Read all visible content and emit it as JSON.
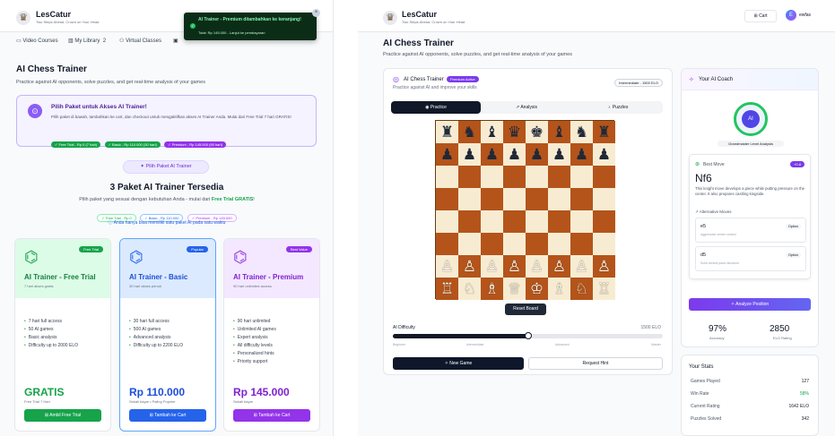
{
  "brand": {
    "name": "LesCatur",
    "tagline": "Two Steps Ahead, Crown on Your Head"
  },
  "left": {
    "nav": [
      {
        "label": "Video Courses",
        "icon": "video-icon"
      },
      {
        "label": "My Library",
        "icon": "library-icon",
        "count": "2"
      },
      {
        "label": "Virtual Classes",
        "icon": "class-icon"
      }
    ],
    "toast": {
      "title": "AI Trainer - Premium ditambahkan ke keranjang!",
      "line": "Total: Rp 145.000 - Lanjut ke pembayaran"
    },
    "page_title": "AI Chess Trainer",
    "page_sub": "Practice against AI opponents, solve puzzles, and get real-time analysis of your games",
    "notice": {
      "title": "Pilih Paket untuk Akses AI Trainer!",
      "body": "Pilih paket di bawah, tambahkan ke cart, dan checkout untuk mengaktifkan akses AI Trainer Anda. Mulai dari Free Trial 7 hari GRATIS!",
      "pills": [
        "✓ Free Trial - Rp 0 (7 hari)",
        "✓ Basic - Rp 110.000 (30 hari)",
        "✓ Premium - Rp 145.000 (90 hari)"
      ]
    },
    "choose_btn": "Pilih Paket AI Trainer",
    "section_title": "3 Paket AI Trainer Tersedia",
    "section_sub_prefix": "Pilih paket yang sesuai dengan kebutuhan Anda - mulai dari ",
    "section_sub_bold": "Free Trial GRATIS",
    "section_sub_suffix": "!",
    "mini_pills": [
      "✓ Free Trial - Rp 0",
      "✓ Basic - Rp 110.000",
      "✓ Premium - Rp 145.000"
    ],
    "info_line": "Anda hanya bisa memiliki satu paket AI pada satu waktu",
    "plans": [
      {
        "badge": "Free Trial",
        "title": "AI Trainer - Free Trial",
        "desc": "7 hari akses gratis",
        "features": [
          "7 hari full access",
          "50 AI games",
          "Basic analysis",
          "Difficulty up to 2000 ELO"
        ],
        "price": "GRATIS",
        "price_sub": "Free Trial 7 Hari",
        "button": "Ambil Free Trial"
      },
      {
        "badge": "Popular",
        "title": "AI Trainer - Basic",
        "desc": "30 hari akses penuh",
        "features": [
          "30 hari full access",
          "500 AI games",
          "Advanced analysis",
          "Difficulty up to 2200 ELO"
        ],
        "price": "Rp 110.000",
        "price_sub": "Sekali bayar • Paling Populer",
        "button": "Tambah ke Cart"
      },
      {
        "badge": "Best Value",
        "title": "AI Trainer - Premium",
        "desc": "90 hari unlimited access",
        "features": [
          "90 hari unlimited",
          "Unlimited AI games",
          "Expert analysis",
          "All difficulty levels",
          "Personalized hints",
          "Priority support"
        ],
        "price": "Rp 145.000",
        "price_sub": "Sekali bayar",
        "button": "Tambah ke Cart"
      }
    ]
  },
  "right": {
    "cart_label": "Cart",
    "user": "ewfas",
    "page_title": "AI Chess Trainer",
    "page_sub": "Practice against AI opponents, solve puzzles, and get real-time analysis of your games",
    "trainer_title": "AI Chess Trainer",
    "premium_badge": "Premium Active",
    "trainer_sub": "Practice against AI and improve your skills",
    "level": "Intermediate - 1500 ELO",
    "tabs": [
      "Practice",
      "Analysis",
      "Puzzles"
    ],
    "reset": "Reset Board",
    "difficulty_label": "AI Difficulty",
    "difficulty_value": "1500 ELO",
    "difficulty_fraction": 0.5,
    "difficulty_marks": [
      "Beginner",
      "Intermediate",
      "Advanced",
      "Master"
    ],
    "new_game": "New Game",
    "hint": "Request Hint",
    "coach_title": "Your AI Coach",
    "coach_avatar": "AI",
    "coach_level": "Grandmaster Level Analysis",
    "best_move_label": "Best Move",
    "best_move_score": "+0.8",
    "best_move": "Nf6",
    "best_move_desc": "This knight move develops a piece while putting pressure on the center. It also prepares castling kingside.",
    "alt_label": "Alternative Moves",
    "alts": [
      {
        "move": "e5",
        "desc": "Aggressive center control",
        "tag": "Option"
      },
      {
        "move": "d5",
        "desc": "Solid central pawn structure",
        "tag": "Option"
      }
    ],
    "analyze": "Analyze Position",
    "accuracy": "97%",
    "accuracy_label": "Accuracy",
    "elo": "2850",
    "elo_label": "ELO Rating",
    "stats_title": "Your Stats",
    "stats": [
      {
        "label": "Games Played",
        "value": "127"
      },
      {
        "label": "Win Rate",
        "value": "58%"
      },
      {
        "label": "Current Rating",
        "value": "1642 ELO"
      },
      {
        "label": "Puzzles Solved",
        "value": "342"
      }
    ],
    "board": [
      [
        "♜",
        "♞",
        "♝",
        "♛",
        "♚",
        "♝",
        "♞",
        "♜"
      ],
      [
        "♟",
        "♟",
        "♟",
        "♟",
        "♟",
        "♟",
        "♟",
        "♟"
      ],
      [
        "",
        "",
        "",
        "",
        "",
        "",
        "",
        ""
      ],
      [
        "",
        "",
        "",
        "",
        "",
        "",
        "",
        ""
      ],
      [
        "",
        "",
        "",
        "",
        "",
        "",
        "",
        ""
      ],
      [
        "",
        "",
        "",
        "",
        "",
        "",
        "",
        ""
      ],
      [
        "♙",
        "♙",
        "♙",
        "♙",
        "♙",
        "♙",
        "♙",
        "♙"
      ],
      [
        "♖",
        "♘",
        "♗",
        "♕",
        "♔",
        "♗",
        "♘",
        "♖"
      ]
    ]
  },
  "colors": {
    "green": "#16a34a",
    "blue": "#2563eb",
    "purple": "#9333ea",
    "dark": "#111827",
    "board_dark": "#b4541a",
    "board_light": "#f7ecd2"
  }
}
